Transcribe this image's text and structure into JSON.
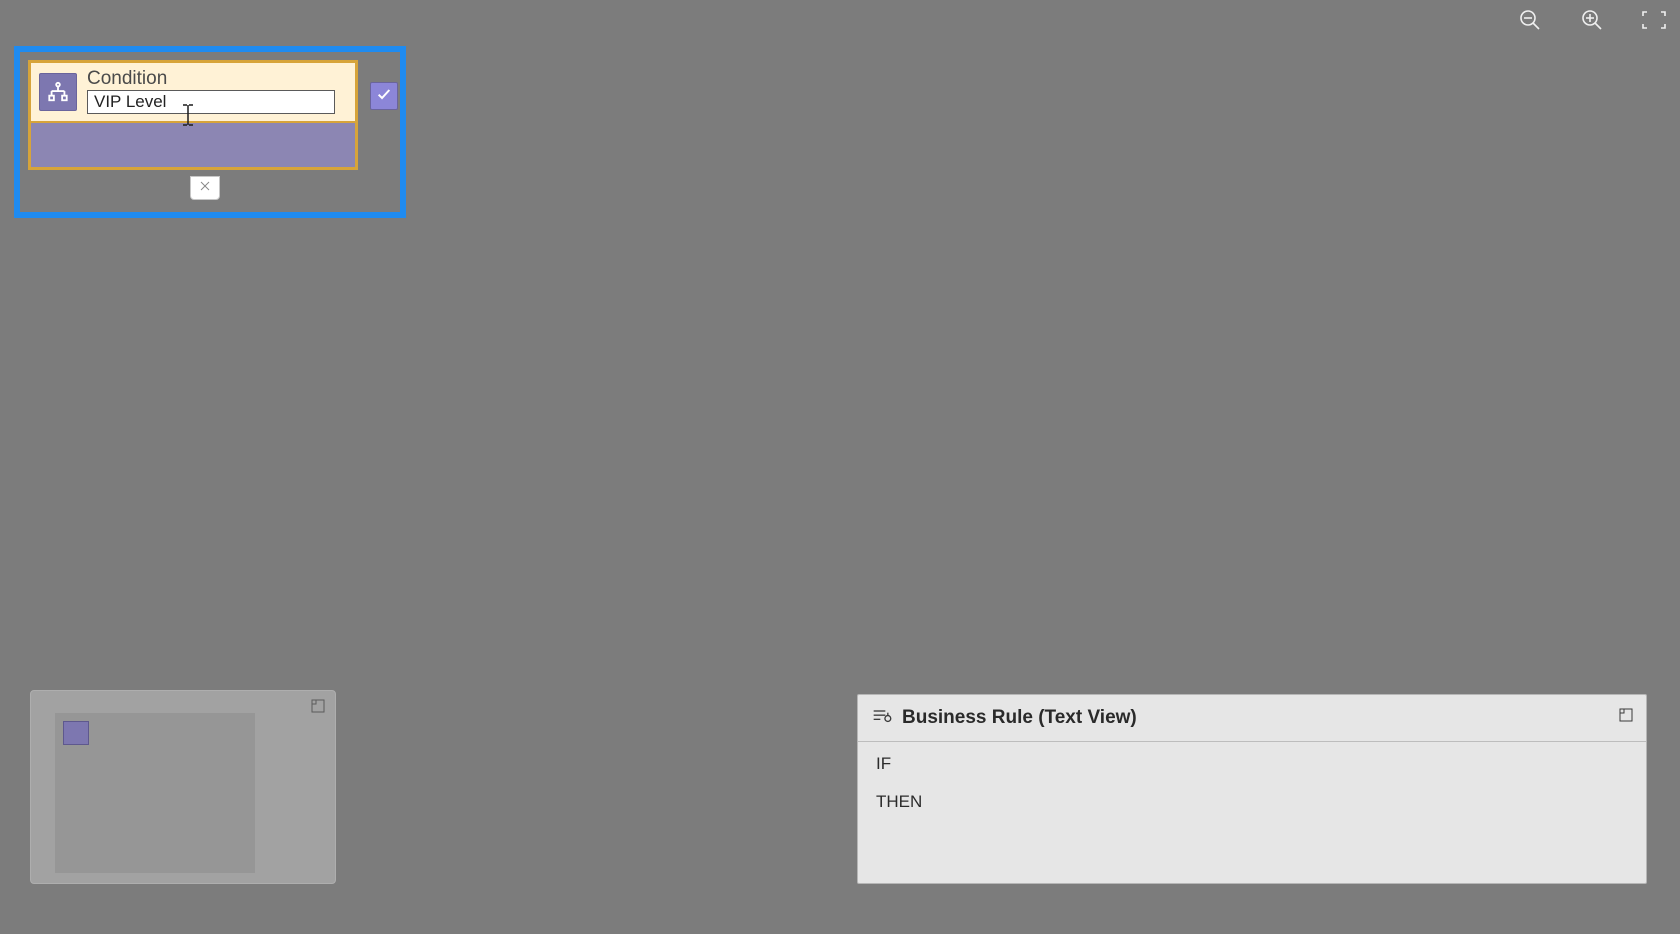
{
  "toolbar": {
    "zoom_out": "zoom-out",
    "zoom_in": "zoom-in",
    "fit": "fit-to-screen"
  },
  "condition": {
    "type_label": "Condition",
    "name_value": "VIP Level",
    "true_branch": "check",
    "false_branch": "x"
  },
  "minimap": {
    "expand": "expand"
  },
  "textview": {
    "title": "Business Rule (Text View)",
    "lines": {
      "if": "IF",
      "then": "THEN"
    }
  }
}
